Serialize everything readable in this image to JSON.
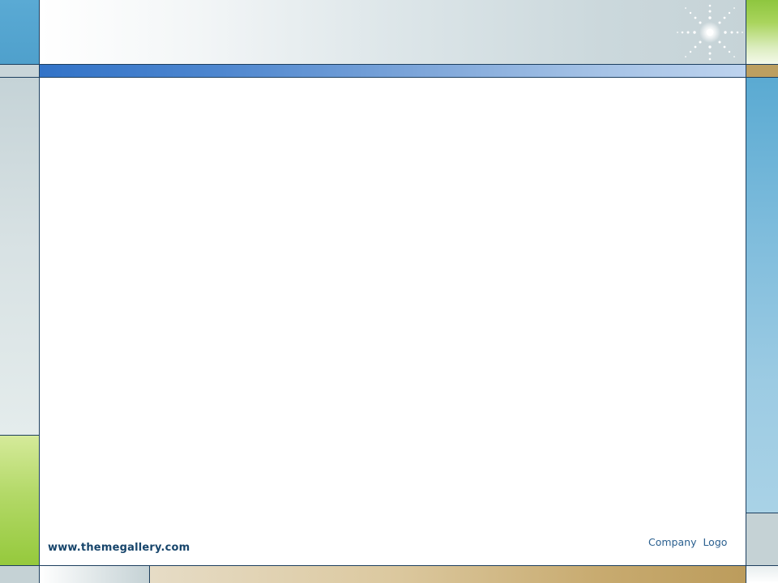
{
  "footer": {
    "website": "www.themegallery.com",
    "company_logo": "Company  Logo"
  },
  "theme": {
    "accent_blue": "#3273c8",
    "sky_blue": "#5aaad4",
    "lime_green": "#8ec63f",
    "tan": "#bc9c5c",
    "slate_gray": "#c5d2d5",
    "border_navy": "#1d3f5f",
    "text_navy": "#17456b"
  },
  "decorations": {
    "sparkle": "sparkle-icon"
  }
}
